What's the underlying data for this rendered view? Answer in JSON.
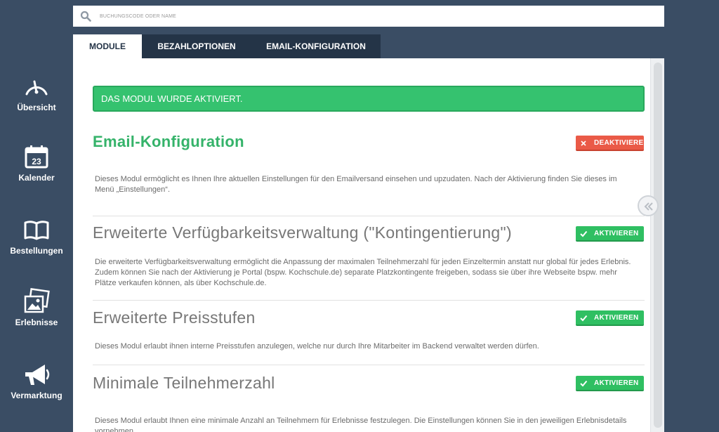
{
  "search": {
    "placeholder": "BUCHUNGSCODE ODER NAME"
  },
  "sidebar": {
    "items": [
      {
        "label": "Übersicht",
        "icon": "speedometer-icon"
      },
      {
        "label": "Kalender",
        "icon": "calendar-icon",
        "day": "23"
      },
      {
        "label": "Bestellungen",
        "icon": "book-icon"
      },
      {
        "label": "Erlebnisse",
        "icon": "photos-icon"
      },
      {
        "label": "Vermarktung",
        "icon": "megaphone-icon"
      }
    ]
  },
  "tabs": [
    {
      "label": "MODULE",
      "active": true
    },
    {
      "label": "BEZAHLOPTIONEN",
      "active": false
    },
    {
      "label": "EMAIL-KONFIGURATION",
      "active": false
    }
  ],
  "alert": {
    "text": "DAS MODUL WURDE AKTIVIERT."
  },
  "modules": [
    {
      "title": "Email-Konfiguration",
      "active": true,
      "button": "DEAKTIVIEREN",
      "description": "Dieses Modul ermöglicht es Ihnen Ihre aktuellen Einstellungen für den Emailversand einsehen und upzudaten. Nach der Aktivierung finden Sie dieses im Menü „Einstellungen“."
    },
    {
      "title": "Erweiterte Verfügbarkeitsverwaltung (\"Kontingentierung\")",
      "active": false,
      "button": "AKTIVIEREN",
      "description": "Die erweiterte Verfügbarkeitsverwaltung ermöglicht die Anpassung der maximalen Teilnehmerzahl für jeden Einzeltermin anstatt nur global für jedes Erlebnis. Zudem können Sie nach der Aktivierung je Portal (bspw. Kochschule.de) separate Platzkontingente freigeben, sodass sie über ihre Webseite bspw. mehr Plätze verkaufen können, als über Kochschule.de."
    },
    {
      "title": "Erweiterte Preisstufen",
      "active": false,
      "button": "AKTIVIEREN",
      "description": "Dieses Modul erlaubt ihnen interne Preisstufen anzulegen, welche nur durch Ihre Mitarbeiter im Backend verwaltet werden dürfen."
    },
    {
      "title": "Minimale Teilnehmerzahl",
      "active": false,
      "button": "AKTIVIEREN",
      "description": "Dieses Modul erlaubt Ihnen eine minimale Anzahl an Teilnehmern für Erlebnisse festzulegen. Die Einstellungen können Sie in den jeweiligen Erlebnisdetails vornehmen."
    }
  ],
  "colors": {
    "sidebar": "#3a4d64",
    "tab_dark": "#243447",
    "success": "#35c26f",
    "title_active": "#35b36a",
    "danger": "#ea5a47"
  }
}
